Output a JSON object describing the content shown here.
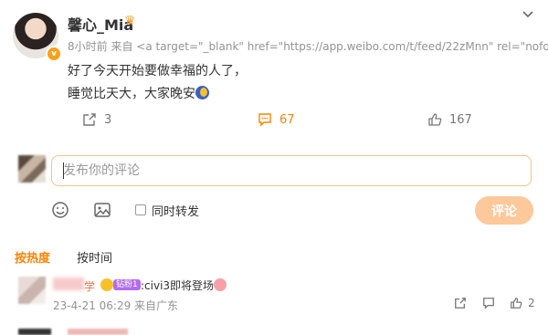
{
  "post": {
    "username": "馨心_Mia",
    "meta": "8小时前 来自 <a target=\"_blank\" href=\"https://app.weibo.com/t/feed/22zMnn\" rel=\"nofol",
    "text_line1": "好了今天开始要做幸福的人了，",
    "text_line2": "睡觉比天大，大家晚安",
    "shares": "3",
    "comments": "67",
    "likes": "167",
    "accent_color": "#ff8200"
  },
  "composer": {
    "placeholder": "发布你的评论",
    "repost_label": "同时转发",
    "submit_label": "评论"
  },
  "sort_tabs": {
    "hot": "按热度",
    "time": "按时间"
  },
  "comment": {
    "name_visible": "学",
    "badge": "钻粉1",
    "text": ":civi3即将登场",
    "meta": "23-4-21 06:29 来自广东",
    "likes": "2"
  }
}
